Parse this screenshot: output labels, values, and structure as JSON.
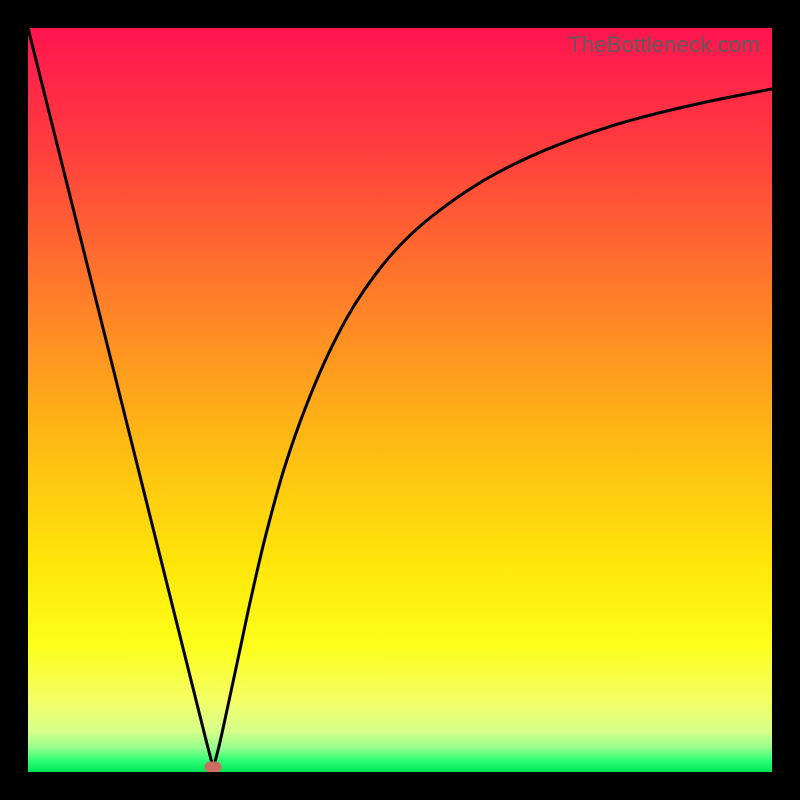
{
  "watermark": "TheBottleneck.com",
  "chart_data": {
    "type": "line",
    "title": "",
    "xlabel": "",
    "ylabel": "",
    "xlim": [
      0,
      1
    ],
    "ylim": [
      0,
      1
    ],
    "x_min_at": 0.249,
    "marker": {
      "x": 0.249,
      "y": 0.007,
      "color": "#cc6f63"
    },
    "background_gradient": {
      "stops": [
        {
          "pos": 0.0,
          "color": "#ff1550"
        },
        {
          "pos": 0.15,
          "color": "#ff3a3f"
        },
        {
          "pos": 0.35,
          "color": "#ff7a2a"
        },
        {
          "pos": 0.55,
          "color": "#ffb815"
        },
        {
          "pos": 0.72,
          "color": "#ffe60a"
        },
        {
          "pos": 0.83,
          "color": "#fdff1a"
        },
        {
          "pos": 0.905,
          "color": "#f4ff68"
        },
        {
          "pos": 0.945,
          "color": "#d7ff8a"
        },
        {
          "pos": 0.968,
          "color": "#93ff8e"
        },
        {
          "pos": 0.985,
          "color": "#2dff73"
        },
        {
          "pos": 1.0,
          "color": "#00e557"
        }
      ]
    },
    "series": [
      {
        "name": "left",
        "x": [
          0.0,
          0.05,
          0.1,
          0.15,
          0.2,
          0.225,
          0.24,
          0.249
        ],
        "y": [
          1.0,
          0.8,
          0.6,
          0.4,
          0.2,
          0.1,
          0.04,
          0.005
        ]
      },
      {
        "name": "right",
        "x": [
          0.249,
          0.258,
          0.27,
          0.285,
          0.3,
          0.32,
          0.345,
          0.375,
          0.41,
          0.45,
          0.5,
          0.56,
          0.63,
          0.71,
          0.8,
          0.9,
          1.0
        ],
        "y": [
          0.005,
          0.04,
          0.095,
          0.165,
          0.235,
          0.32,
          0.41,
          0.495,
          0.575,
          0.645,
          0.708,
          0.76,
          0.805,
          0.842,
          0.873,
          0.898,
          0.918
        ]
      }
    ]
  }
}
